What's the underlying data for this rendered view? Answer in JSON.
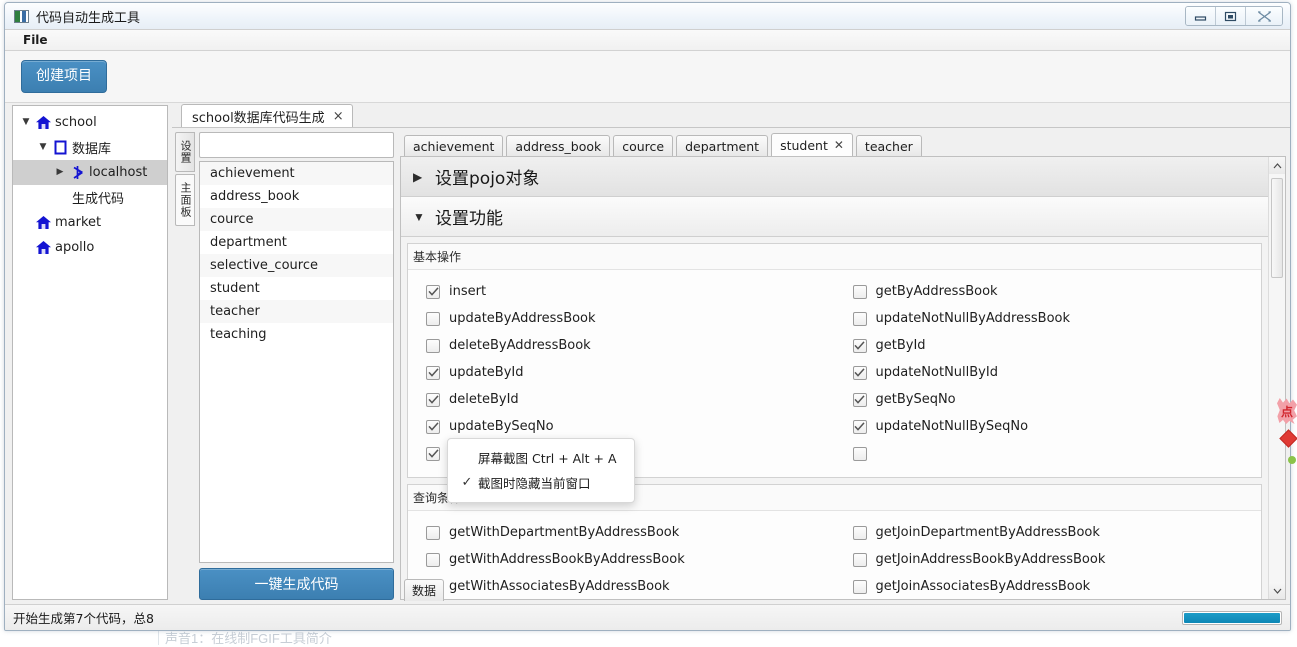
{
  "window": {
    "title": "代码自动生成工具",
    "icon": "app-icon",
    "controls": {
      "minimize": "minimize-icon",
      "maximize": "maximize-icon",
      "close": "close-icon"
    }
  },
  "menubar": {
    "items": [
      "File"
    ]
  },
  "toolbar": {
    "create_project_label": "创建项目"
  },
  "tree": {
    "nodes": [
      {
        "label": "school",
        "icon": "home-icon",
        "arrow": "▼",
        "indent": 0,
        "selected": false
      },
      {
        "label": "数据库",
        "icon": "database-icon",
        "arrow": "▼",
        "indent": 1,
        "selected": false
      },
      {
        "label": "localhost",
        "icon": "connection-icon",
        "arrow": "▶",
        "indent": 2,
        "selected": true
      },
      {
        "label": "生成代码",
        "icon": "",
        "arrow": "",
        "indent": 1,
        "selected": false
      },
      {
        "label": "market",
        "icon": "home-icon",
        "arrow": "",
        "indent": 0,
        "selected": false
      },
      {
        "label": "apollo",
        "icon": "home-icon",
        "arrow": "",
        "indent": 0,
        "selected": false
      }
    ]
  },
  "document_tab": {
    "label": "school数据库代码生成",
    "close": "×"
  },
  "side_tabs": [
    {
      "label": "设置",
      "active": false
    },
    {
      "label": "主面板",
      "active": true
    }
  ],
  "table_list": {
    "search_value": "",
    "search_placeholder": "",
    "items": [
      "achievement",
      "address_book",
      "cource",
      "department",
      "selective_cource",
      "student",
      "teacher",
      "teaching"
    ],
    "generate_button_label": "一键生成代码"
  },
  "table_tabs": [
    {
      "label": "achievement",
      "active": false,
      "closable": false
    },
    {
      "label": "address_book",
      "active": false,
      "closable": false
    },
    {
      "label": "cource",
      "active": false,
      "closable": false
    },
    {
      "label": "department",
      "active": false,
      "closable": false
    },
    {
      "label": "student",
      "active": true,
      "closable": true
    },
    {
      "label": "teacher",
      "active": false,
      "closable": false
    }
  ],
  "accordion": [
    {
      "title": "设置pojo对象",
      "arrow": "▶",
      "open": false
    },
    {
      "title": "设置功能",
      "arrow": "▼",
      "open": true
    }
  ],
  "groups": [
    {
      "title": "基本操作",
      "left": [
        {
          "label": "insert",
          "checked": true
        },
        {
          "label": "updateByAddressBook",
          "checked": false
        },
        {
          "label": "deleteByAddressBook",
          "checked": false
        },
        {
          "label": "updateById",
          "checked": true
        },
        {
          "label": "deleteById",
          "checked": true
        },
        {
          "label": "updateBySeqNo",
          "checked": true
        },
        {
          "label": "",
          "checked": true
        }
      ],
      "right": [
        {
          "label": "getByAddressBook",
          "checked": false
        },
        {
          "label": "updateNotNullByAddressBook",
          "checked": false
        },
        {
          "label": "getById",
          "checked": true
        },
        {
          "label": "updateNotNullById",
          "checked": true
        },
        {
          "label": "getBySeqNo",
          "checked": true
        },
        {
          "label": "updateNotNullBySeqNo",
          "checked": true
        },
        {
          "label": "",
          "checked": false
        }
      ]
    },
    {
      "title": "查询条件",
      "left": [
        {
          "label": "getWithDepartmentByAddressBook",
          "checked": false
        },
        {
          "label": "getWithAddressBookByAddressBook",
          "checked": false
        },
        {
          "label": "getWithAssociatesByAddressBook",
          "checked": false
        }
      ],
      "right": [
        {
          "label": "getJoinDepartmentByAddressBook",
          "checked": false
        },
        {
          "label": "getJoinAddressBookByAddressBook",
          "checked": false
        },
        {
          "label": "getJoinAssociatesByAddressBook",
          "checked": false
        }
      ]
    }
  ],
  "bottom_tab": {
    "label": "数据"
  },
  "statusbar": {
    "text": "开始生成第7个代码，总8",
    "progress_percent": 100
  },
  "context_menu": {
    "items": [
      {
        "label": "屏幕截图 Ctrl + Alt + A",
        "checked": false
      },
      {
        "label": "截图时隐藏当前窗口",
        "checked": true
      }
    ],
    "check_glyph": "✓"
  },
  "edge_badge": {
    "label": "点",
    "diamond": "diamond-marker",
    "dot": "status-dot"
  },
  "background": {
    "text": "声音1：在线制FGIF工具简介"
  },
  "colors": {
    "accent_blue": "#3c7fb1",
    "progress_blue": "#0d87b5",
    "tree_icon_blue": "#1414d2",
    "selection_gray": "#cfcfcf",
    "badge_red": "#d1262e"
  },
  "scrollbar": {
    "up": "chevron-up-icon",
    "down": "chevron-down-icon"
  }
}
